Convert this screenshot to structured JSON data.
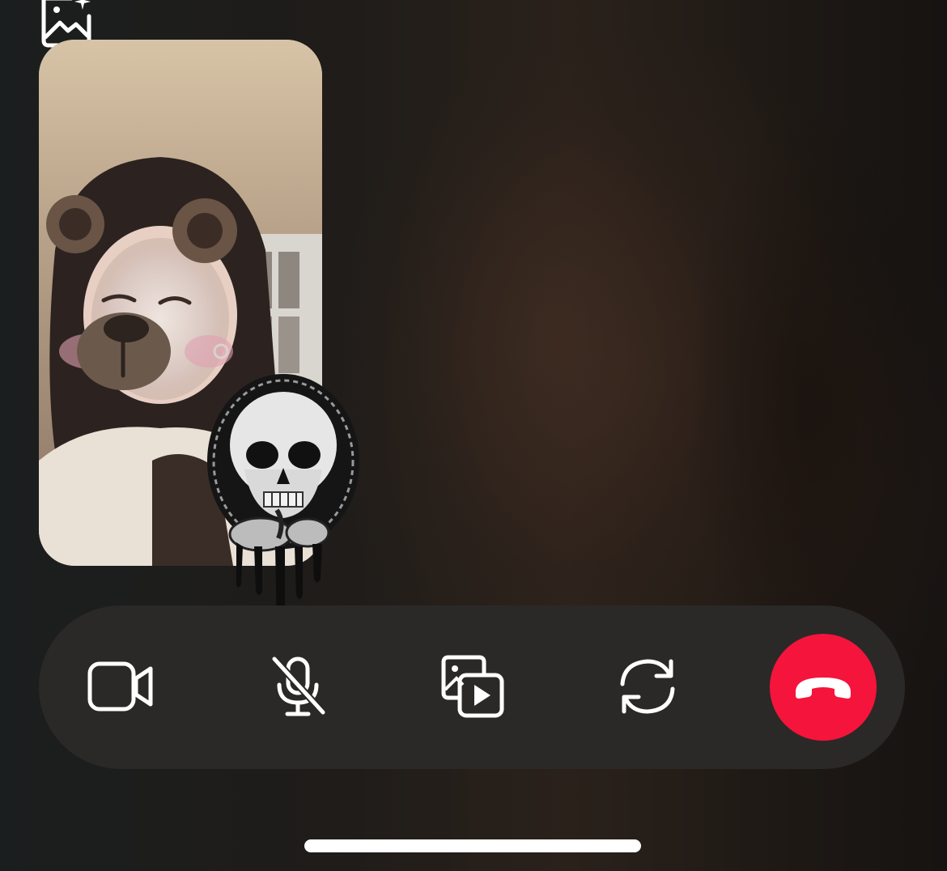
{
  "call": {
    "local_video": {
      "filter": "bear"
    },
    "sticker": {
      "name": "skull-sticker"
    }
  },
  "toolbar": {
    "effects_icon": "photo-effects-icon",
    "buttons": [
      {
        "name": "camera-toggle-button",
        "icon": "video-camera-icon"
      },
      {
        "name": "mute-button",
        "icon": "microphone-muted-icon"
      },
      {
        "name": "share-media-button",
        "icon": "photo-video-share-icon"
      },
      {
        "name": "flip-camera-button",
        "icon": "camera-flip-icon"
      },
      {
        "name": "end-call-button",
        "icon": "phone-hangup-icon"
      }
    ]
  },
  "colors": {
    "end_call": "#f5143c",
    "controls_bar": "#2b2927",
    "icon": "#ffffff"
  }
}
